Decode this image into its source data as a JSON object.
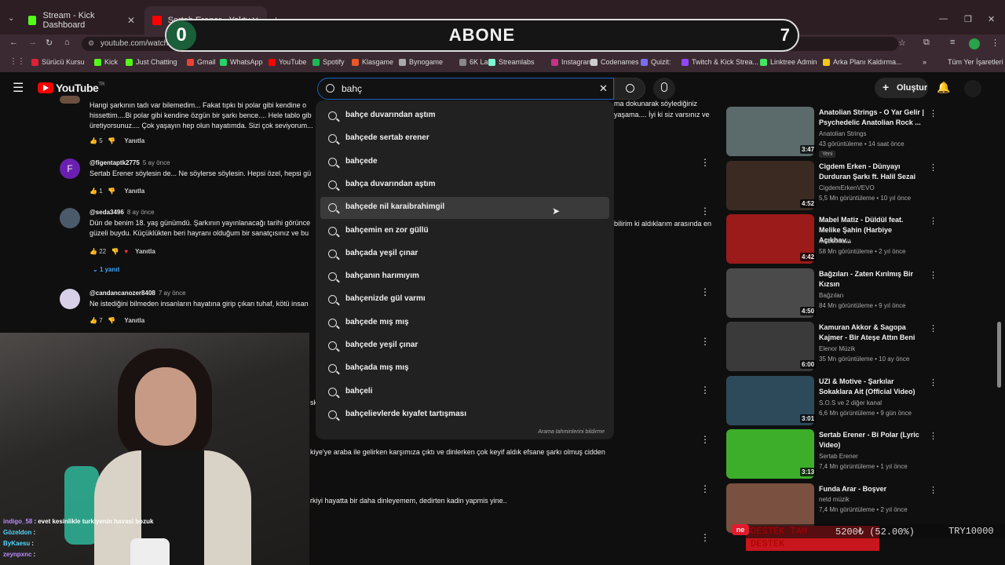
{
  "browser": {
    "tabs": [
      {
        "title": "Stream - Kick Dashboard",
        "color": "#53fc18"
      },
      {
        "title": "Sertab Erener - Yoktuğun D",
        "color": "#ff0000"
      }
    ],
    "url": "youtube.com/watch?v=...EDs8&list=RDcJ96c0s8FY8&index=2",
    "bookmarks": [
      {
        "label": "Sürücü Kursu",
        "color": "#d23"
      },
      {
        "label": "Kick",
        "color": "#53fc18"
      },
      {
        "label": "Just Chatting",
        "color": "#53fc18"
      },
      {
        "label": "Gmail",
        "color": "#ea4335"
      },
      {
        "label": "WhatsApp",
        "color": "#25d366"
      },
      {
        "label": "YouTube",
        "color": "#ff0000"
      },
      {
        "label": "Spotify",
        "color": "#1db954"
      },
      {
        "label": "Klasgame",
        "color": "#e8562a"
      },
      {
        "label": "Bynogame",
        "color": "#aaa"
      },
      {
        "label": "6K Labs",
        "color": "#888"
      },
      {
        "label": "Streamlabs",
        "color": "#80f5d2"
      },
      {
        "label": "Instagram",
        "color": "#c13584"
      },
      {
        "label": "Codenames",
        "color": "#ccc"
      },
      {
        "label": "Quizit:",
        "color": "#7b6cf6"
      },
      {
        "label": "Twitch & Kick Strea...",
        "color": "#9146ff"
      },
      {
        "label": "Linktree Admin",
        "color": "#43e660"
      },
      {
        "label": "Arka Planı Kaldırma...",
        "color": "#f5c518"
      },
      {
        "label": "»",
        "color": "transparent"
      },
      {
        "label": "Tüm Yer İşaretleri",
        "color": "transparent"
      }
    ]
  },
  "overlay": {
    "left_count": "0",
    "title": "ABONE",
    "right_count": "7"
  },
  "youtube": {
    "logo": "YouTube",
    "logo_sup": "TR",
    "search_value": "bahç",
    "create_label": "Oluştur"
  },
  "comments": [
    {
      "user": "",
      "time": "",
      "text": "Hangi şarkının tadı var bilemedim... Fakat tıpkı bi polar gibi kendine o\nhissettim....Bi polar gibi kendine özgün bir şarkı bence.... Hele tablo gib\nüretiyorsunuz.... Çok yaşayın hep olun hayatımda. Sizi çok seviyorum...",
      "likes": "5",
      "reply": "Yanıtla"
    },
    {
      "user": "@figentaptk2775",
      "time": "5 ay önce",
      "text": "Sertab Erener söylesin de... Ne söylerse söylesin. Hepsi özel, hepsi gü",
      "likes": "1",
      "reply": "Yanıtla",
      "avatar_letter": "F"
    },
    {
      "user": "@seda3496",
      "time": "8 ay önce",
      "text": "Dün de benim 18. yaş günümdü. Şarkının yayınlanacağı tarihi görünce\ngüzeli buydu. Küçüklükten beri hayranı olduğum bir sanatçısınız ve bu",
      "likes": "22",
      "reply": "Yanıtla",
      "replies": "1 yanıt"
    },
    {
      "user": "@candancanozer8408",
      "time": "7 ay önce",
      "text": "Ne istediğini bilmeden insanların hayatına girip çıkan tuhaf, kötü insan",
      "likes": "7",
      "reply": "Yanıtla"
    }
  ],
  "comment_fragments": [
    "ma dokunarak söylediğiniz",
    "yaşama.... İyi ki siz varsınız ve",
    "bilirim ki aldıklarım arasında en",
    "kiye'ye araba ile gelirken karşımıza çıktı ve dinlerken çok keyif aldık efsane şarkı olmuş cidden",
    "rkiyi hayatta  bir daha dinleyemem, dedirten kadin yapmis yine..",
    "sk"
  ],
  "suggestions": [
    "bahçe duvarından aştım",
    "bahçede sertab erener",
    "bahçede",
    "bahça duvarından aştım",
    "bahçede nil karaibrahimgil",
    "bahçemin en zor güllü",
    "bahçada yeşil çınar",
    "bahçanın harımıyım",
    "bahçenizde gül varmı",
    "bahçede mış mış",
    "bahçede yeşil çınar",
    "bahçada mış mış",
    "bahçeli",
    "bahçelievlerde kıyafet tartışması"
  ],
  "suggestions_footer": "Arama tahminlerini bildirme",
  "related": [
    {
      "title": "Anatolian Strings - O Yar Gelir | Psychedelic Anatolian Rock ...",
      "channel": "Anatolian Strings",
      "stats": "43 görüntüleme • 14 saat önce",
      "duration": "3:47",
      "badge": "Yeni",
      "color": "#5b6a6a"
    },
    {
      "title": "Cigdem Erken - Dünyayı Durduran Şarkı ft. Halil Sezai",
      "channel": "CigdemErkenVEVO",
      "stats": "5,5 Mn görüntüleme • 10 yıl önce",
      "duration": "4:52",
      "color": "#3a2a22"
    },
    {
      "title": "Mabel Matiz - Düldül feat. Melike Şahin (Harbiye Açıkhav...",
      "channel": "mabelmatiz",
      "stats": "58 Mn görüntüleme • 2 yıl önce",
      "duration": "4:42",
      "color": "#9b1a1a"
    },
    {
      "title": "Bağzıları - Zaten Kırılmış Bir Kızsın",
      "channel": "Bağzıları",
      "stats": "84 Mn görüntüleme • 9 yıl önce",
      "duration": "4:50",
      "color": "#4a4a4a"
    },
    {
      "title": "Kamuran Akkor & Sagopa Kajmer - Bir Ateşe Attın Beni",
      "channel": "Elenor Müzik",
      "stats": "35 Mn görüntüleme • 10 ay önce",
      "duration": "6:00",
      "color": "#3a3a3a"
    },
    {
      "title": "UZI & Motive - Şarkılar Sokaklara Ait (Official Video)",
      "channel": "S.O.S ve 2 diğer kanal",
      "stats": "6,6 Mn görüntüleme • 9 gün önce",
      "duration": "3:01",
      "color": "#2d4a5a"
    },
    {
      "title": "Sertab Erener - Bi Polar (Lyric Video)",
      "channel": "Sertab Erener",
      "stats": "7,4 Mn görüntüleme • 1 yıl önce",
      "duration": "3:13",
      "color": "#3cae2a"
    },
    {
      "title": "Funda Arar - Boşver",
      "channel": "netd müzik",
      "stats": "7,4 Mn görüntüleme • 2 yıl önce",
      "duration": "",
      "color": "#7a5040"
    }
  ],
  "chat": [
    {
      "user": "indigo_58",
      "text": ": evet kesinlikle turkiyenin havasi bozuk",
      "color": "#b98cff"
    },
    {
      "user": "Gözeldon",
      "text": ":",
      "color": "#4fd6ff"
    },
    {
      "user": "ByKaesu",
      "text": ":",
      "color": "#4fd6ff"
    },
    {
      "user": "zeynpxnc",
      "text": ":",
      "color": "#b98cff"
    }
  ],
  "destek": {
    "line1": "DESTEK TAM",
    "line2": "DESTEK",
    "amount": "5200₺ (52.00%)",
    "code": "TRY10000"
  }
}
